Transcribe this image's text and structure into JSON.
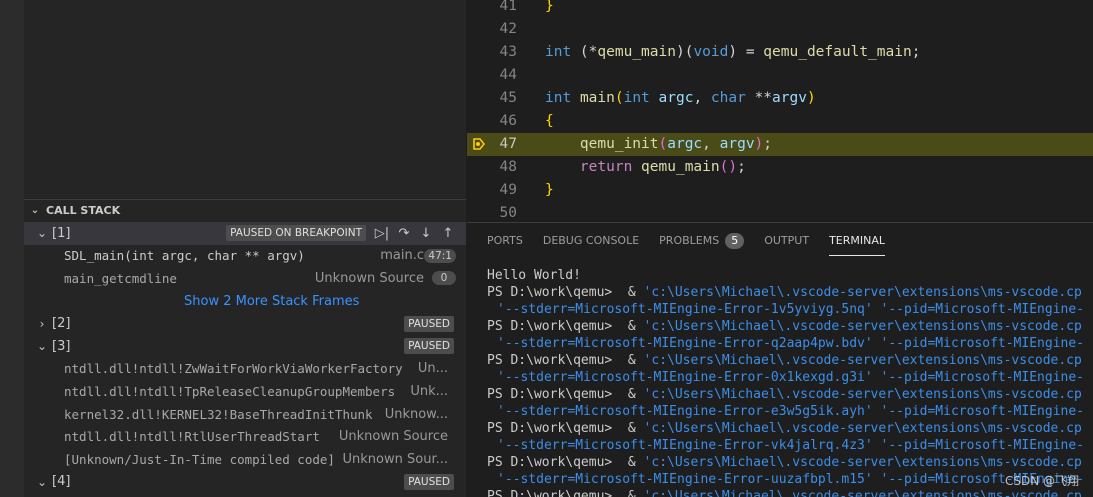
{
  "call_stack": {
    "title": "CALL STACK",
    "threads": [
      {
        "name": "[1]",
        "status": "PAUSED ON BREAKPOINT",
        "frames": [
          {
            "name": "SDL_main(int argc, char ** argv)",
            "source": "main.c",
            "position": "47:1"
          },
          {
            "name": "main_getcmdline",
            "source": "Unknown Source",
            "count": "0"
          }
        ],
        "show_more": "Show 2 More Stack Frames"
      },
      {
        "name": "[2]",
        "status": "PAUSED"
      },
      {
        "name": "[3]",
        "status": "PAUSED",
        "frames": [
          {
            "name": "ntdll.dll!ntdll!ZwWaitForWorkViaWorkerFactory",
            "source": "Un..."
          },
          {
            "name": "ntdll.dll!ntdll!TpReleaseCleanupGroupMembers",
            "source": "Unk..."
          },
          {
            "name": "kernel32.dll!KERNEL32!BaseThreadInitThunk",
            "source": "Unknow..."
          },
          {
            "name": "ntdll.dll!ntdll!RtlUserThreadStart",
            "source": "Unknown Source"
          },
          {
            "name": "[Unknown/Just-In-Time compiled code]",
            "source": "Unknown Sour..."
          }
        ]
      },
      {
        "name": "[4]",
        "status": "PAUSED"
      }
    ],
    "controls": [
      "step-over-icon",
      "step-into-icon",
      "step-out-icon"
    ]
  },
  "editor": {
    "lines": [
      {
        "num": "41"
      },
      {
        "num": "42"
      },
      {
        "num": "43"
      },
      {
        "num": "44"
      },
      {
        "num": "45"
      },
      {
        "num": "46"
      },
      {
        "num": "47"
      },
      {
        "num": "48"
      },
      {
        "num": "49"
      },
      {
        "num": "50"
      }
    ],
    "code": {
      "l41": "}",
      "l43_type": "int",
      "l43_a": " (*",
      "l43_fn": "qemu_main",
      "l43_b": ")(",
      "l43_void": "void",
      "l43_c": ") = ",
      "l43_val": "qemu_default_main",
      "l43_d": ";",
      "l45_type": "int",
      "l45_fn": "main",
      "l45_int": "int",
      "l45_argc": "argc",
      "l45_char": "char",
      "l45_stars": " **",
      "l45_argv": "argv",
      "l46": "{",
      "l47_fn": "qemu_init",
      "l47_argc": "argc",
      "l47_argv": "argv",
      "l48_ret": "return",
      "l48_fn": "qemu_main",
      "l49": "}"
    }
  },
  "panel": {
    "tabs": [
      {
        "label": "PORTS"
      },
      {
        "label": "DEBUG CONSOLE"
      },
      {
        "label": "PROBLEMS",
        "count": "5"
      },
      {
        "label": "OUTPUT"
      },
      {
        "label": "TERMINAL",
        "active": true
      }
    ],
    "terminal": {
      "hello": "Hello World!",
      "prompt": "PS D:\\work\\qemu>  & ",
      "cmd": "'c:\\Users\\Michael\\.vscode-server\\extensions\\ms-vscode.cp",
      "args": [
        "'--stderr=Microsoft-MIEngine-Error-1v5yviyg.5nq' '--pid=Microsoft-MIEngine-",
        "'--stderr=Microsoft-MIEngine-Error-q2aap4pw.bdv' '--pid=Microsoft-MIEngine-",
        "'--stderr=Microsoft-MIEngine-Error-0x1kexgd.g3i' '--pid=Microsoft-MIEngine-",
        "'--stderr=Microsoft-MIEngine-Error-e3w5g5ik.ayh' '--pid=Microsoft-MIEngine-",
        "'--stderr=Microsoft-MIEngine-Error-vk4jalrq.4z3' '--pid=Microsoft-MIEngine-",
        "'--stderr=Microsoft-MIEngine-Error-uuzafbpl.m15' '--pid=Microsoft-MIEngine-"
      ]
    }
  },
  "watermark": "CSDN @飞翔",
  "colors": {
    "current_line": "#4b4b18",
    "breakpoint_arrow": "#ffcc00",
    "link": "#3794ff"
  }
}
